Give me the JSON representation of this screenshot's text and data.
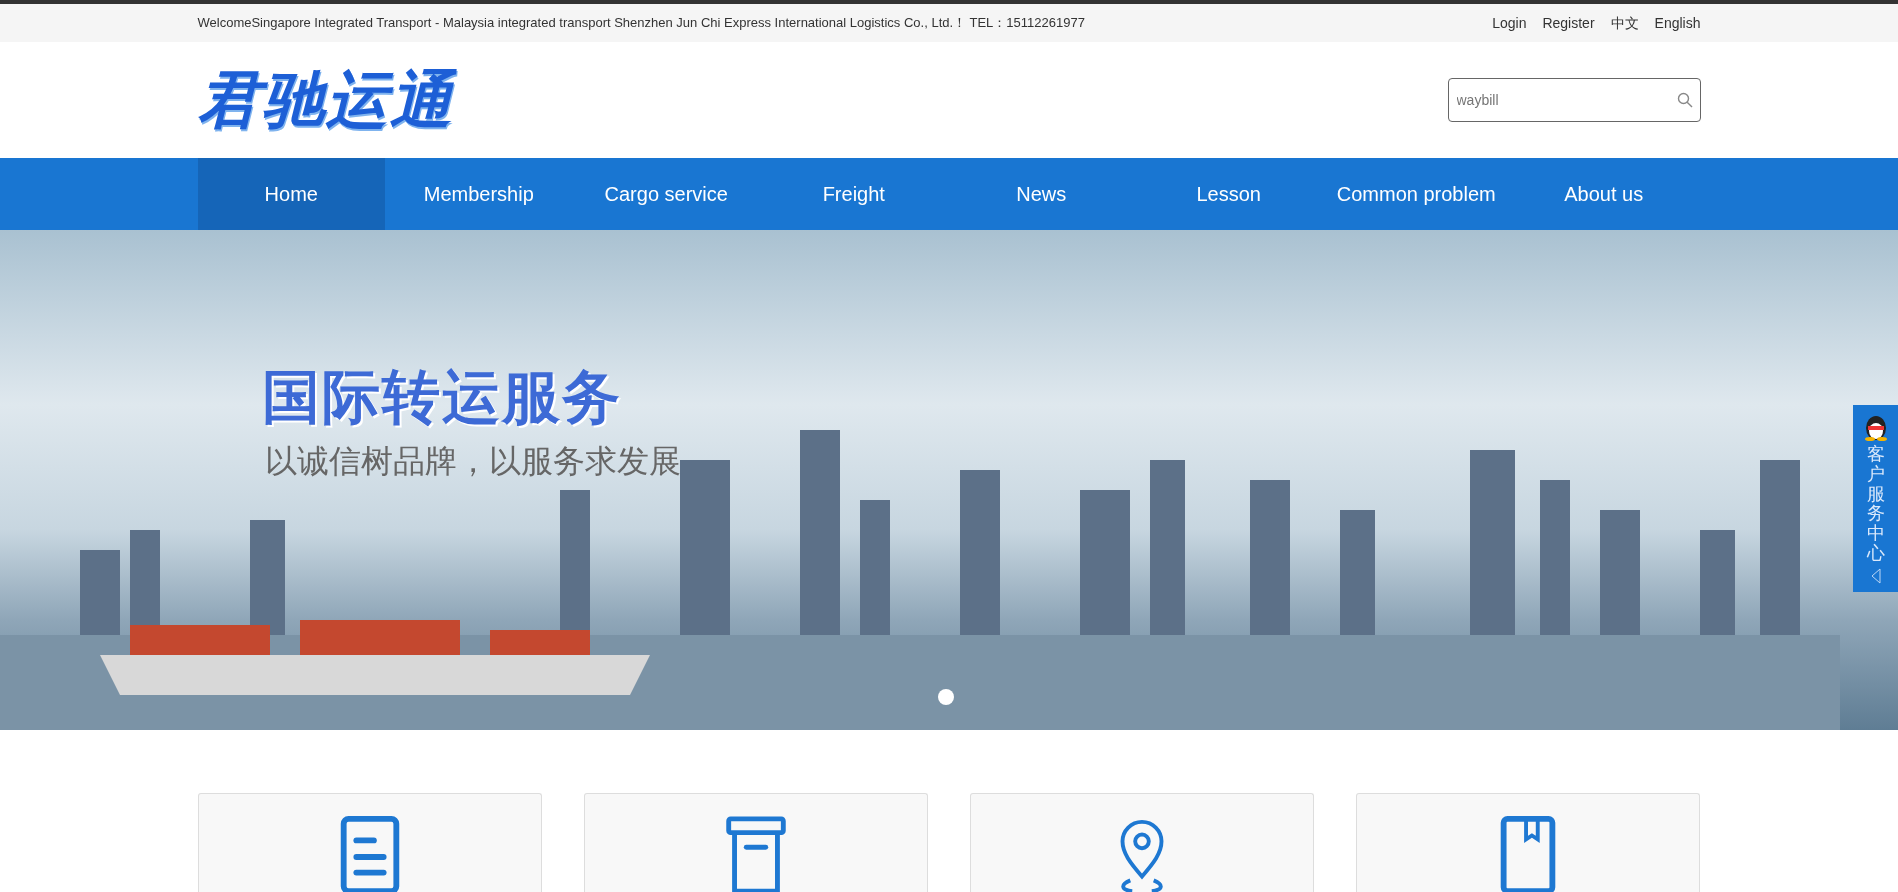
{
  "top_bar": {
    "welcome": "WelcomeSingapore Integrated Transport - Malaysia integrated transport Shenzhen Jun Chi Express International Logistics Co., Ltd.！ TEL：15112261977",
    "links": [
      "Login",
      "Register",
      "中文",
      "English"
    ]
  },
  "header": {
    "logo": "君驰运通",
    "search": {
      "placeholder": "waybill"
    }
  },
  "nav": [
    {
      "label": "Home",
      "selected": true
    },
    {
      "label": "Membership",
      "selected": false
    },
    {
      "label": "Cargo service",
      "selected": false
    },
    {
      "label": "Freight",
      "selected": false
    },
    {
      "label": "News",
      "selected": false
    },
    {
      "label": "Lesson",
      "selected": false
    },
    {
      "label": "Common problem",
      "selected": false
    },
    {
      "label": "About us",
      "selected": false
    }
  ],
  "banner": {
    "title": "国际转运服务",
    "subtitle": "以诚信树品牌，以服务求发展",
    "dots": [
      {
        "selected": true
      }
    ]
  },
  "side_widget": {
    "label": "客户服务中心"
  },
  "cards": [
    {
      "kind": "document"
    },
    {
      "kind": "box"
    },
    {
      "kind": "location"
    },
    {
      "kind": "bookmark"
    }
  ]
}
